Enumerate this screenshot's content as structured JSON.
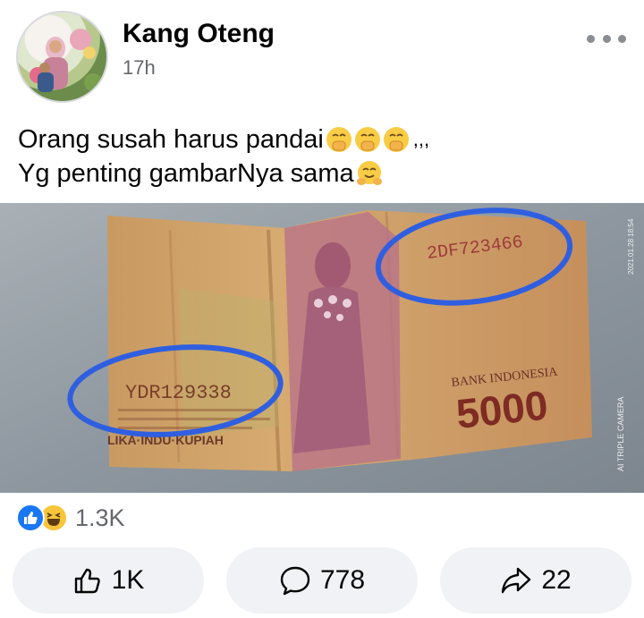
{
  "post": {
    "author": "Kang Oteng",
    "time": "17h",
    "text_line1": "Orang susah harus pandai",
    "text_line1_suffix": ",,,",
    "text_line2": "Yg penting gambarNya sama",
    "emoji_line1": [
      "hand-over-mouth-emoji",
      "hand-over-mouth-emoji",
      "hand-over-mouth-emoji"
    ],
    "emoji_line2": [
      "hugging-face-emoji"
    ]
  },
  "photo": {
    "serial_left": "YDR129338",
    "serial_right": "2DF723466",
    "bank_name": "BANK INDONESIA",
    "denomination": "5000",
    "partial_text": "LIKA·INDU·KUPIAH",
    "watermark_camera": "AI TRIPLE CAMERA",
    "watermark_date": "2021.01.28 18:54",
    "highlight_color": "#2f5fe0"
  },
  "reactions": {
    "icons": [
      "like-icon",
      "haha-icon"
    ],
    "count": "1.3K"
  },
  "actions": {
    "like_count": "1K",
    "comment_count": "778",
    "share_count": "22"
  },
  "colors": {
    "brand_blue": "#1877f2",
    "secondary_text": "#65676b",
    "button_bg": "#f0f2f5"
  }
}
